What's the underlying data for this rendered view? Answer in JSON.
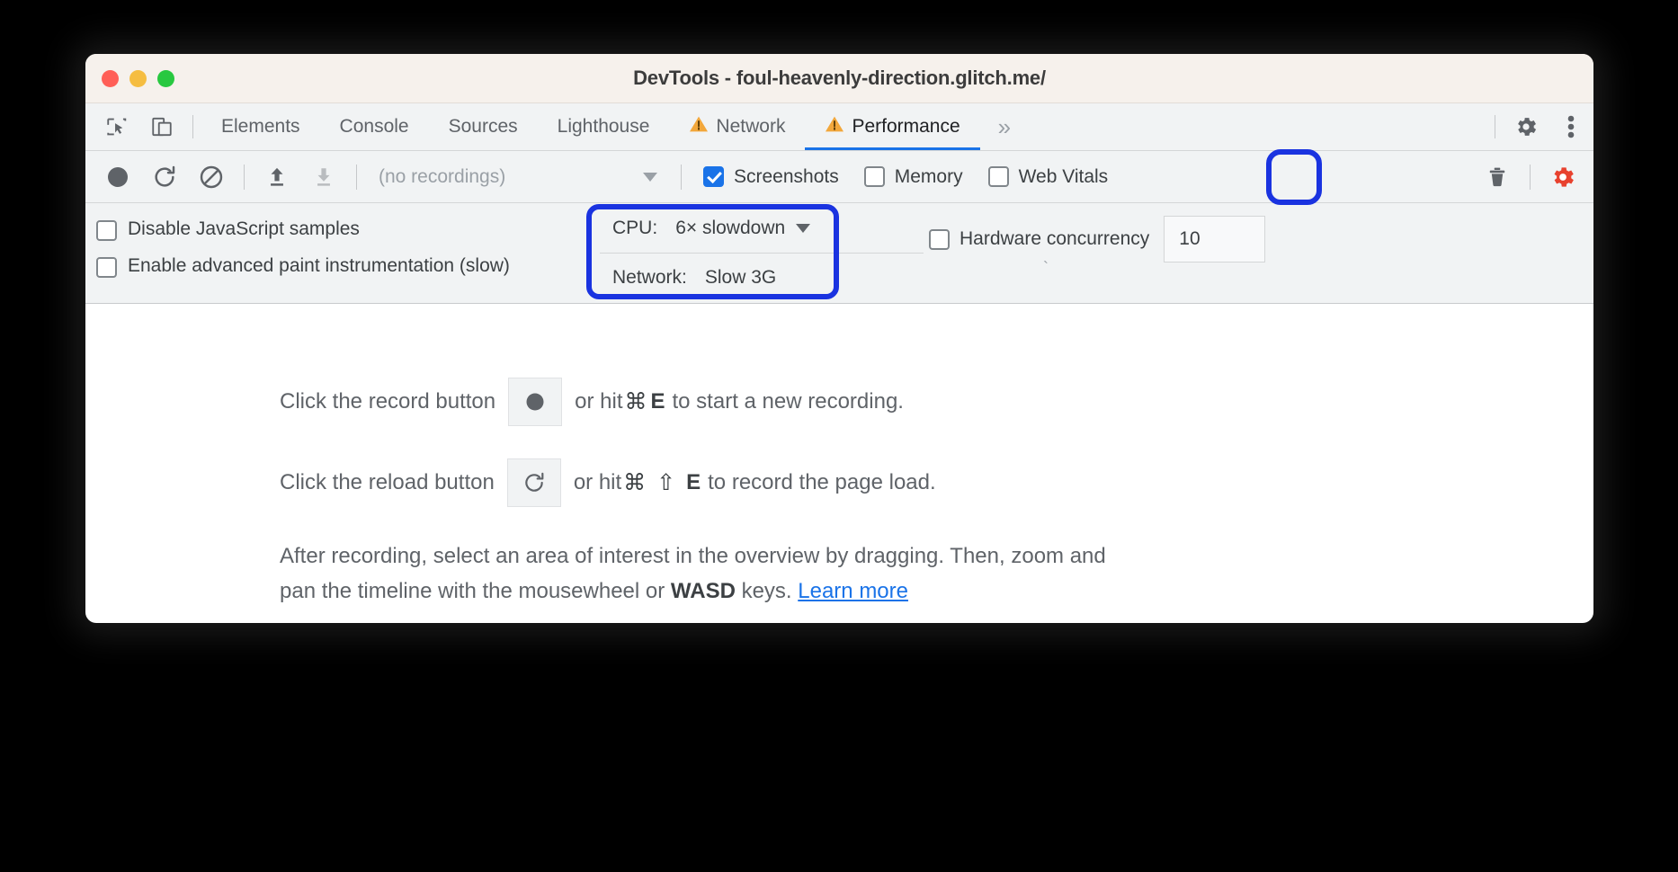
{
  "window": {
    "title": "DevTools - foul-heavenly-direction.glitch.me/",
    "traffic_lights": [
      "close",
      "minimize",
      "maximize"
    ]
  },
  "tabbar": {
    "left_icons": [
      {
        "name": "inspect-element-icon",
        "label": "Inspect element"
      },
      {
        "name": "device-toolbar-icon",
        "label": "Toggle device toolbar"
      }
    ],
    "tabs": [
      {
        "label": "Elements",
        "selected": false,
        "warning": false
      },
      {
        "label": "Console",
        "selected": false,
        "warning": false
      },
      {
        "label": "Sources",
        "selected": false,
        "warning": false
      },
      {
        "label": "Lighthouse",
        "selected": false,
        "warning": false
      },
      {
        "label": "Network",
        "selected": false,
        "warning": true
      },
      {
        "label": "Performance",
        "selected": true,
        "warning": true
      }
    ],
    "overflow_label": "»",
    "right_icons": [
      {
        "name": "settings-gear-icon",
        "label": "Settings"
      },
      {
        "name": "more-options-kebab-icon",
        "label": "Customize and control DevTools"
      }
    ]
  },
  "toolbar": {
    "buttons": [
      {
        "name": "record-button",
        "label": "Record"
      },
      {
        "name": "reload-and-record-button",
        "label": "Start profiling and reload page"
      },
      {
        "name": "clear-button",
        "label": "Clear"
      },
      {
        "name": "load-profile-button",
        "label": "Load profile"
      },
      {
        "name": "save-profile-button",
        "label": "Save profile"
      }
    ],
    "recordings_select": {
      "value": "(no recordings)",
      "caret": "▼"
    },
    "checkboxes": [
      {
        "label": "Screenshots",
        "checked": true
      },
      {
        "label": "Memory",
        "checked": false
      },
      {
        "label": "Web Vitals",
        "checked": false
      }
    ],
    "trash_label": "Clear recordings",
    "capture_settings_label": "Capture settings",
    "capture_settings_color": "#e8412e",
    "capture_settings_active": true
  },
  "settings_pane": {
    "checkboxes": [
      {
        "label": "Disable JavaScript samples",
        "checked": false
      },
      {
        "label": "Enable advanced paint instrumentation (slow)",
        "checked": false
      }
    ],
    "throttling": {
      "cpu": {
        "key": "CPU:",
        "value": "6× slowdown",
        "caret": "▼"
      },
      "network": {
        "key": "Network:",
        "value": "Slow 3G"
      }
    },
    "hardware_concurrency": {
      "label": "Hardware concurrency",
      "checked": false,
      "value": "10"
    },
    "stray_mark": "`"
  },
  "content": {
    "record_instruction": {
      "prefix": "Click the record button",
      "mid": "or hit",
      "key_cmd": "⌘",
      "key_letter": "E",
      "suffix": "to start a new recording."
    },
    "reload_instruction": {
      "prefix": "Click the reload button",
      "mid": "or hit",
      "key_cmd": "⌘",
      "key_shift": "⇧",
      "key_letter": "E",
      "suffix": "to record the page load."
    },
    "paragraph": {
      "part1": "After recording, select an area of interest in the overview by dragging. Then, zoom and pan the timeline with the mousewheel or ",
      "bold": "WASD",
      "part2": " keys. ",
      "link": "Learn more"
    }
  },
  "annotations": {
    "highlight_color": "#1a33e0",
    "regions": [
      {
        "name": "throttling-highlight",
        "target": "cpu-and-network-throttling"
      },
      {
        "name": "capture-settings-highlight",
        "target": "capture-settings-button"
      }
    ]
  }
}
